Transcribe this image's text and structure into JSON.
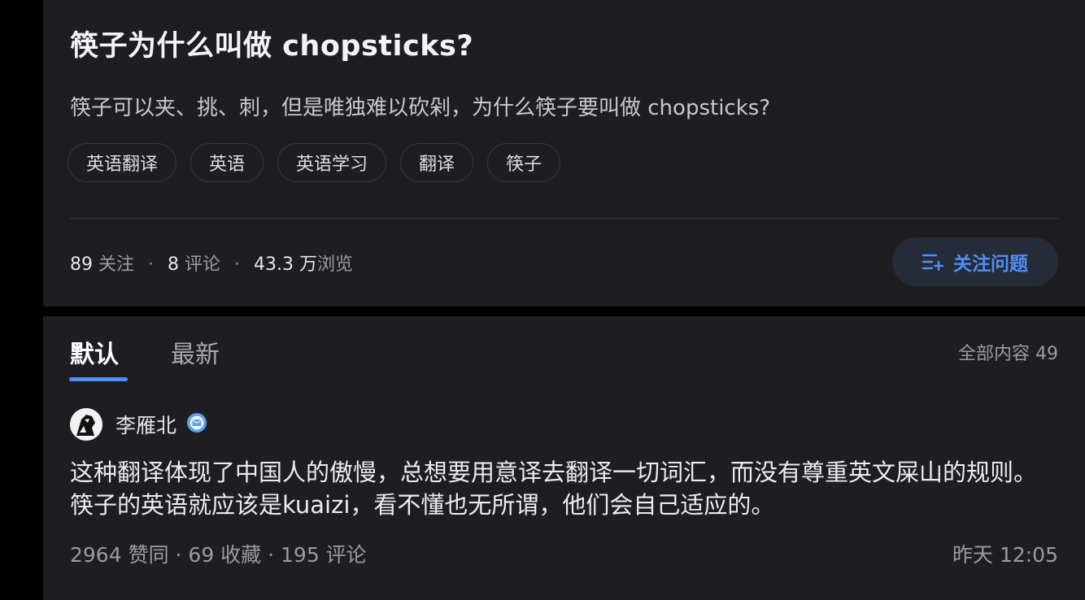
{
  "question": {
    "title": "筷子为什么叫做 chopsticks?",
    "description": "筷子可以夹、挑、刺，但是唯独难以砍剁，为什么筷子要叫做 chopsticks?",
    "tags": [
      "英语翻译",
      "英语",
      "英语学习",
      "翻译",
      "筷子"
    ],
    "stats": {
      "followers_count": "89",
      "followers_label": "关注",
      "comments_count": "8",
      "comments_label": "评论",
      "views_count": "43.3 万",
      "views_label": "浏览"
    },
    "follow_button_label": "关注问题"
  },
  "answers": {
    "tabs": [
      {
        "label": "默认",
        "active": true
      },
      {
        "label": "最新",
        "active": false
      }
    ],
    "total_label": "全部内容 49",
    "answer": {
      "author_name": "李雁北",
      "text": "这种翻译体现了中国人的傲慢，总想要用意译去翻译一切词汇，而没有尊重英文屎山的规则。  筷子的英语就应该是kuaizi，看不懂也无所谓，他们会自己适应的。",
      "meta": "2964 赞同 · 69 收藏 · 195 评论",
      "time": "昨天 12:05"
    }
  },
  "colors": {
    "background": "#000000",
    "card": "#1e1e22",
    "accent": "#4f8ef5",
    "button_bg": "#262b38"
  },
  "icons": [
    "follow-question-icon",
    "verified-badge-icon",
    "avatar-image"
  ]
}
